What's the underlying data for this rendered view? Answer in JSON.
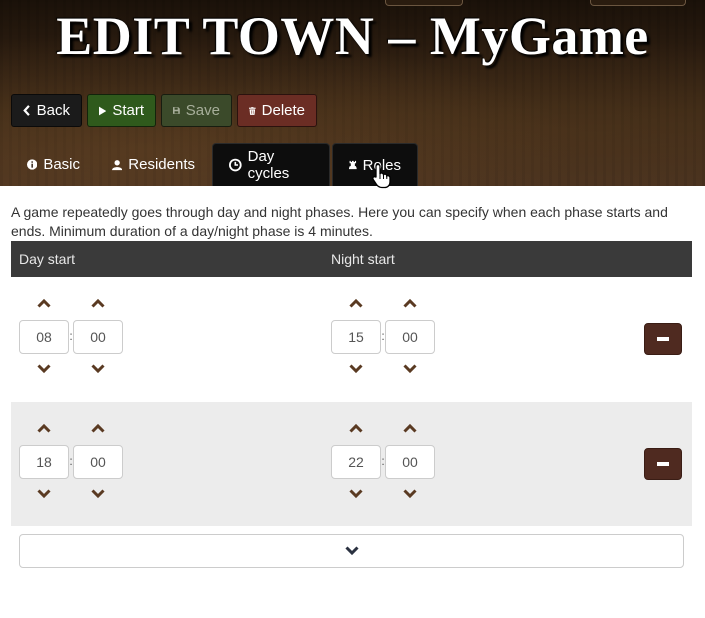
{
  "header": {
    "title": "EDIT TOWN – MyGame"
  },
  "toolbar": {
    "back_label": "Back",
    "start_label": "Start",
    "save_label": "Save",
    "delete_label": "Delete"
  },
  "tabs": [
    {
      "label": "Basic",
      "icon": "info-circle-icon"
    },
    {
      "label": "Residents",
      "icon": "user-icon"
    },
    {
      "label": "Day cycles",
      "icon": "clock-icon",
      "active": true
    },
    {
      "label": "Roles",
      "icon": "chess-rook-icon"
    }
  ],
  "description": "A game repeatedly goes through day and night phases. Here you can specify when each phase starts and ends. Minimum duration of a day/night phase is 4 minutes.",
  "table": {
    "headers": {
      "day": "Day start",
      "night": "Night start"
    },
    "rows": [
      {
        "day": {
          "hour": "08",
          "minute": "00"
        },
        "night": {
          "hour": "15",
          "minute": "00"
        }
      },
      {
        "day": {
          "hour": "18",
          "minute": "00"
        },
        "night": {
          "hour": "22",
          "minute": "00"
        }
      }
    ],
    "separator": ":"
  },
  "colors": {
    "accent_brown": "#4f2a20",
    "arrow_brown": "#5a3a22",
    "header_row": "#3a3a3a",
    "start_green": "#2f5a1c",
    "delete_red": "#6b2d24"
  }
}
